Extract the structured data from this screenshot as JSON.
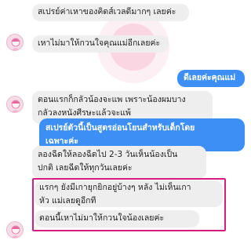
{
  "colors": {
    "incoming_bubble": "#eeeeee",
    "outgoing_bubble": "#3d8ff5",
    "highlight_border": "#d81b7e",
    "watermark": "#f3a6c4"
  },
  "messages": [
    {
      "side": "incoming",
      "text": "สเปรย์ค่าเหาของคิดส์เวลดีมากๆ เลยค่ะ"
    },
    {
      "side": "incoming",
      "text": "เหาไม่มาให้กวนใจคุณแม่อีกเลยค่ะ"
    },
    {
      "side": "outgoing",
      "text": "ดีเลยค่ะคุณแม่"
    },
    {
      "side": "incoming",
      "text": "ตอนแรกก็กลัวน้องจะแพ เพราะน้องผมบาง\nกลัวลงหนังศีรษะแล้วจะแพ้"
    },
    {
      "side": "outgoing",
      "text": "สเปรย์ตัวนี้เป็นสูตรอ่อนโยนสำหรับเด็กโดย\nเฉพาะค่ะ"
    },
    {
      "side": "incoming",
      "text": "ลองฉีดให้ลองฉีดไป 2-3 วันเห็นน้องเป็น\nปกติ เลยฉีดให้ทุกวันเลยค่ะ"
    },
    {
      "side": "incoming",
      "text": "แรกๆ ยังมีเกายุกยิกอยู่บ้างๆ หลัง ไม่เห็นเกา\nหัว แม่เลยดูอีกที"
    },
    {
      "side": "incoming",
      "text": "ตอนนี้เหาไม่มาให้กวนใจน้องเลยค่ะ"
    }
  ],
  "avatar_icon": "girl-avatar-icon",
  "watermark_icon": "brand-watermark-icon"
}
